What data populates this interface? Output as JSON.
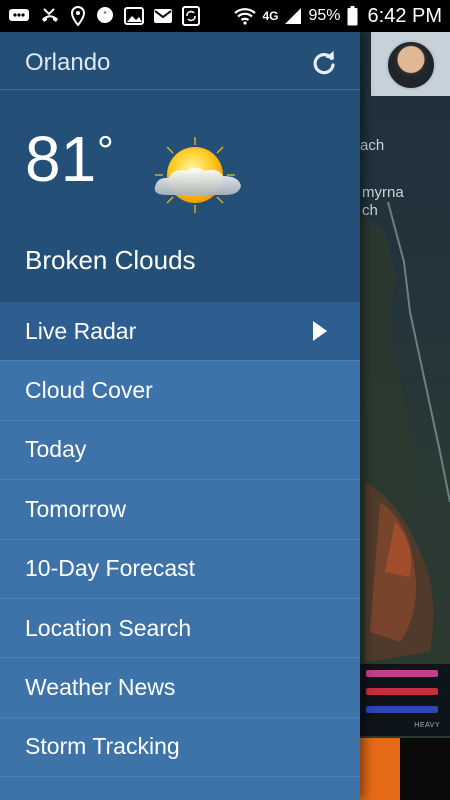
{
  "status_bar": {
    "battery_percent": "95%",
    "time": "6:42 PM",
    "network": "4G",
    "icons": [
      "message-icon",
      "missed-call-icon",
      "location-icon",
      "chat-bubble-icon",
      "gallery-icon",
      "mail-icon",
      "sync-icon",
      "wifi-icon",
      "lte-icon",
      "signal-icon",
      "battery-icon"
    ]
  },
  "map": {
    "labels": [
      "ach",
      "myrna",
      "ch"
    ],
    "legend_label": "HEAVY"
  },
  "drawer": {
    "city": "Orlando",
    "temperature": "81",
    "degree_symbol": "°",
    "condition": "Broken Clouds",
    "weather_icon": "partly-cloudy-icon",
    "menu_items": [
      {
        "label": "Live Radar",
        "active": true
      },
      {
        "label": "Cloud Cover"
      },
      {
        "label": "Today"
      },
      {
        "label": "Tomorrow"
      },
      {
        "label": "10-Day Forecast"
      },
      {
        "label": "Location Search"
      },
      {
        "label": "Weather News"
      },
      {
        "label": "Storm Tracking"
      }
    ]
  },
  "colors": {
    "drawer_header": "#245078",
    "menu_bg": "#3d73a9",
    "menu_active": "#2e5e8f"
  }
}
